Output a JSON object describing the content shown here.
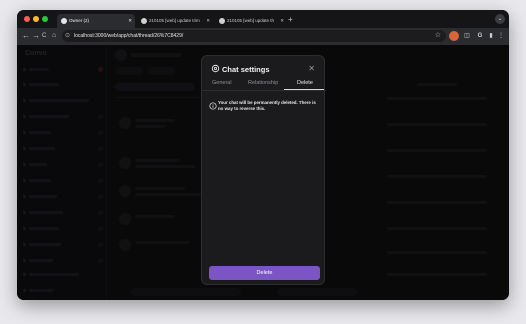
{
  "browser": {
    "tabs": [
      {
        "title": "Owner (2)",
        "active": true
      },
      {
        "title": "210105 [web] update trim",
        "active": false
      },
      {
        "title": "210105 [web] update th",
        "active": false
      }
    ],
    "new_tab_label": "+",
    "tabs_menu_label": "⌄",
    "url": "localhost:3000/web/app/chat/thread/26%7C8429/",
    "nav": {
      "back": "←",
      "forward": "→",
      "reload": "C",
      "home": "⌂"
    }
  },
  "app": {
    "brand": "Convo"
  },
  "modal": {
    "title": "Chat settings",
    "close_label": "✕",
    "tabs": [
      {
        "label": "General",
        "selected": false
      },
      {
        "label": "Relationship",
        "selected": false
      },
      {
        "label": "Delete",
        "selected": true
      }
    ],
    "warning": "Your chat will be permanently deleted. There is no way to reverse this.",
    "delete_button": "Delete"
  },
  "colors": {
    "accent": "#7c55c4",
    "modal_bg": "#1b1b1e",
    "page_bg": "#e9e9ed"
  }
}
